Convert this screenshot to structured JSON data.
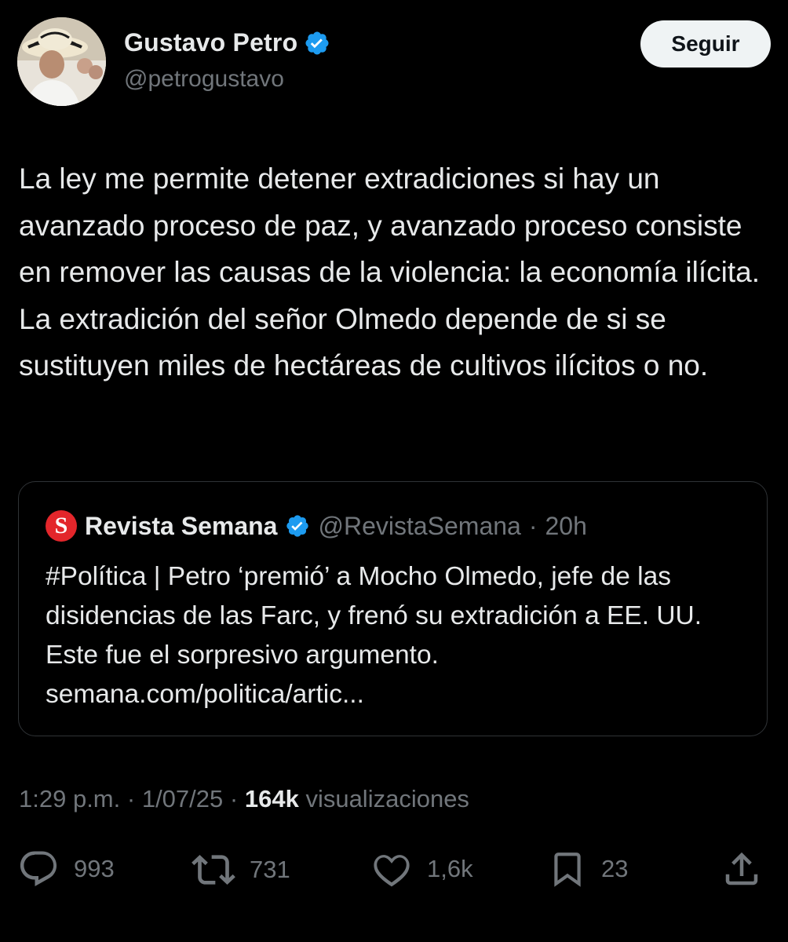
{
  "tweet": {
    "author": {
      "display_name": "Gustavo Petro",
      "handle": "@petrogustavo",
      "verified": true
    },
    "follow_label": "Seguir",
    "text": "La ley me permite detener extradiciones si hay un avanzado proceso de paz, y avanzado proceso consiste en remover las causas de la violencia: la economía ilícita. La extradición del señor Olmedo depende de si se sustituyen miles de hectáreas de cultivos ilícitos o no.",
    "quote": {
      "logo_letter": "S",
      "name": "Revista Semana",
      "handle": "@RevistaSemana",
      "separator": "·",
      "time": "20h",
      "text": "#Política | Petro ‘premió’ a Mocho Olmedo, jefe de las disidencias de las Farc, y frenó su extradición a EE. UU. Este fue el sorpresivo argumento. semana.com/politica/artic..."
    },
    "meta": {
      "time": "1:29 p.m.",
      "sep1": "·",
      "date": "1/07/25",
      "sep2": "·",
      "views_count": "164k",
      "views_label": "visualizaciones"
    },
    "actions": {
      "replies": "993",
      "retweets": "731",
      "likes": "1,6k",
      "bookmarks": "23"
    }
  },
  "icons": {
    "verified": "verified-badge-icon",
    "reply": "reply-icon",
    "retweet": "retweet-icon",
    "like": "heart-icon",
    "bookmark": "bookmark-icon",
    "share": "share-icon"
  },
  "colors": {
    "background": "#000000",
    "text": "#e7e9ea",
    "secondary": "#71767b",
    "verified_blue": "#1d9bf0",
    "follow_bg": "#eff3f4",
    "semana_red": "#e3262b",
    "border": "#2f3336"
  }
}
